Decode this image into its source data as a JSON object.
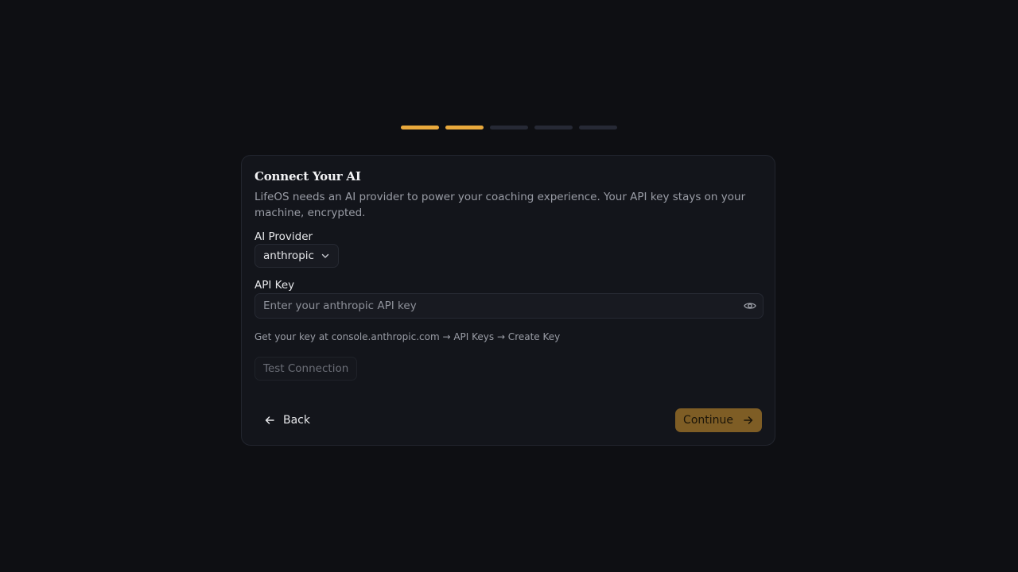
{
  "onboarding": {
    "progress": {
      "total_steps": 5,
      "current_step": 2
    }
  },
  "card": {
    "title": "Connect Your AI",
    "description": "LifeOS needs an AI provider to power your coaching experience. Your API key stays on your machine, encrypted."
  },
  "provider": {
    "label": "AI Provider",
    "selected": "anthropic",
    "icon": "chevron-down-icon"
  },
  "api_key": {
    "label": "API Key",
    "value": "",
    "placeholder": "Enter your anthropic API key",
    "icon": "eye-icon",
    "hint": "Get your key at console.anthropic.com → API Keys → Create Key"
  },
  "actions": {
    "test_connection": "Test Connection",
    "back": "Back",
    "continue": "Continue"
  },
  "colors": {
    "accent": "#e9a93c",
    "accent_disabled": "#7e5d25",
    "background": "#0e0f13",
    "card": "#13151b"
  }
}
